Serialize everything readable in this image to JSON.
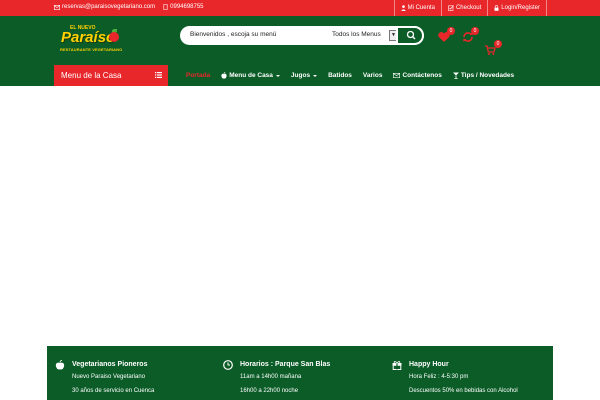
{
  "topbar": {
    "email": "reservas@paraisovegetariano.com",
    "phone": "0994698755",
    "links": [
      {
        "label": "Mi Cuenta"
      },
      {
        "label": "Checkout"
      },
      {
        "label": "Login/Register"
      }
    ]
  },
  "logo": {
    "top": "EL NUEVO",
    "name": "Paraíso",
    "sub": "RESTAURANTE VEGETARIANO"
  },
  "search": {
    "value": "Bienvenidos , escoja su menú",
    "category": "Todos los Menus"
  },
  "header_icons": {
    "wishlist_count": "0",
    "compare_count": "0",
    "cart_count": "0"
  },
  "navbar": {
    "category_label": "Menu de la Casa",
    "items": [
      {
        "label": "Portada"
      },
      {
        "label": "Menu de Casa"
      },
      {
        "label": "Jugos"
      },
      {
        "label": "Batidos"
      },
      {
        "label": "Varios"
      },
      {
        "label": "Contáctenos"
      },
      {
        "label": "Tips / Novedades"
      }
    ]
  },
  "footer": {
    "cols": [
      {
        "title": "Vegetarianos Pioneros",
        "line1": "Nuevo Paraiso Vegetariano",
        "line2": "30 años de servicio en Cuenca"
      },
      {
        "title": "Horarios : Parque San Blas",
        "line1": "11am a 14h00 mañana",
        "line2": "16h00 a 22h00 noche"
      },
      {
        "title": "Happy Hour",
        "line1": "Hora Feliz : 4-5:30 pm",
        "line2": "Descuentos 50% en bebidas con Alcohol"
      }
    ]
  },
  "colors": {
    "brand_red": "#e8272b",
    "brand_green": "#0b5c27",
    "logo_yellow": "#ffd200"
  }
}
